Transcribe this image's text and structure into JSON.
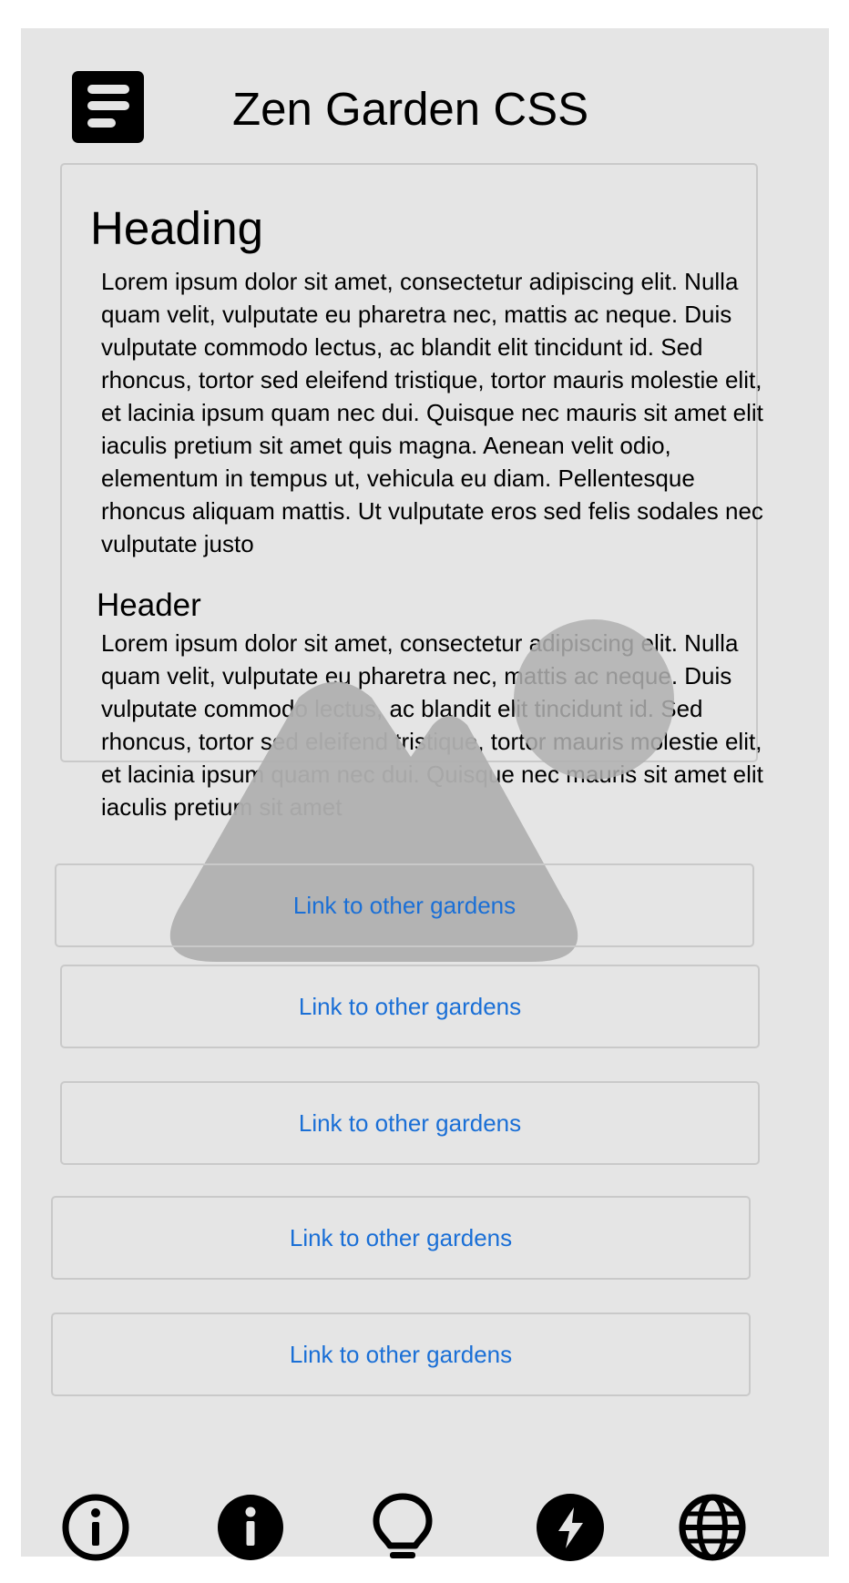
{
  "header": {
    "title": "Zen Garden CSS",
    "menu_icon": "hamburger-menu-icon"
  },
  "article": {
    "heading": "Heading",
    "paragraph1": "Lorem ipsum dolor sit amet, consectetur adipiscing elit. Nulla quam velit, vulputate eu pharetra nec, mattis ac neque. Duis vulputate commodo lectus, ac blandit elit tincidunt id. Sed rhoncus, tortor sed eleifend tristique, tortor mauris molestie elit, et lacinia ipsum quam nec dui. Quisque nec mauris sit amet elit iaculis pretium sit amet quis magna. Aenean velit odio, elementum in tempus ut, vehicula eu diam. Pellentesque rhoncus aliquam mattis. Ut vulputate eros sed felis sodales nec vulputate justo",
    "subheading": "Header",
    "paragraph2": "Lorem ipsum dolor sit amet, consectetur adipiscing elit. Nulla quam velit, vulputate eu pharetra nec, mattis ac neque. Duis vulputate commodo lectus, ac blandit elit tincidunt id. Sed rhoncus, tortor sed eleifend tristique, tortor mauris molestie elit, et lacinia ipsum quam nec dui. Quisque nec mauris sit amet elit iaculis pretium sit amet",
    "image_placeholder_icon": "image-placeholder-icon"
  },
  "links": [
    {
      "label": "Link to other gardens"
    },
    {
      "label": "Link to other gardens"
    },
    {
      "label": "Link to other gardens"
    },
    {
      "label": "Link to other gardens"
    },
    {
      "label": "Link to other gardens"
    }
  ],
  "bottom_nav": {
    "icons": [
      "info-outline-icon",
      "info-filled-icon",
      "lightbulb-icon",
      "lightning-icon",
      "globe-icon"
    ]
  },
  "colors": {
    "background": "#e5e5e5",
    "link": "#1a6fd6",
    "placeholder": "#b0b0b0",
    "border": "#c9c9c9"
  }
}
